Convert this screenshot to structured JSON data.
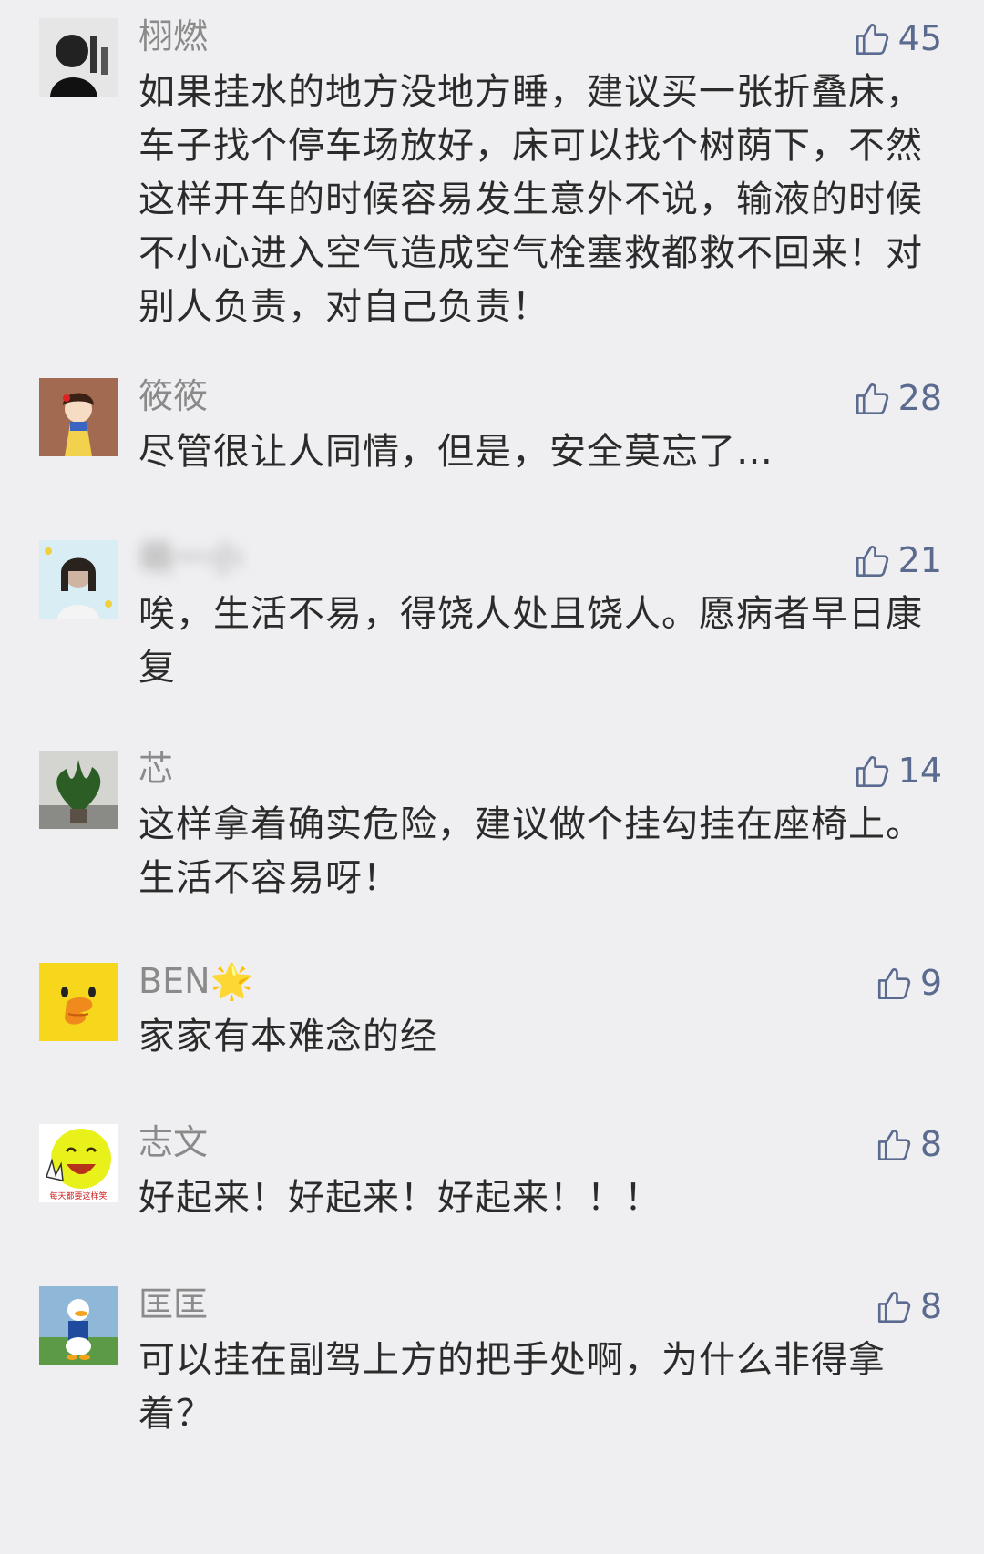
{
  "comments": [
    {
      "name": "栩燃",
      "likes": "45",
      "text": "如果挂水的地方没地方睡，建议买一张折叠床，车子找个停车场放好，床可以找个树荫下，不然这样开车的时候容易发生意外不说，输液的时候不小心进入空气造成空气栓塞救都救不回来！对别人负责，对自己负责！"
    },
    {
      "name": "筱筱",
      "likes": "28",
      "text": "尽管很让人同情，但是，安全莫忘了…"
    },
    {
      "name": "萌一小",
      "likes": "21",
      "text": "唉，生活不易，得饶人处且饶人。愿病者早日康复"
    },
    {
      "name": "芯",
      "likes": "14",
      "text": "这样拿着确实危险，建议做个挂勾挂在座椅上。生活不容易呀！"
    },
    {
      "name": "BEN🌟",
      "likes": "9",
      "text": "家家有本难念的经"
    },
    {
      "name": "志文",
      "likes": "8",
      "text": "好起来！好起来！好起来！！！",
      "avatar_caption": "每天都要这样笑"
    },
    {
      "name": "匡匡",
      "likes": "8",
      "text": "可以挂在副驾上方的把手处啊，为什么非得拿着？"
    }
  ],
  "colors": {
    "background": "#efeff1",
    "name": "#8a8a8a",
    "text": "#2b2b2b",
    "like": "#5b6a8f"
  },
  "icons": {
    "like": "thumbs-up-icon"
  }
}
